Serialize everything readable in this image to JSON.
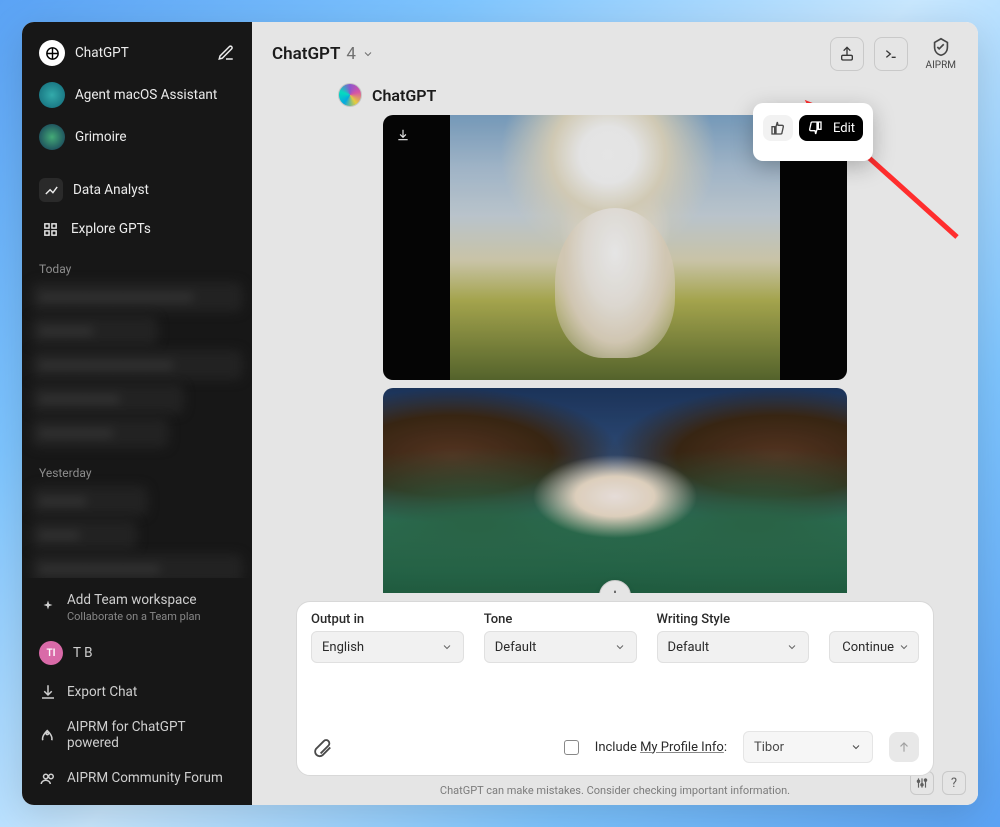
{
  "sidebar": {
    "app_name": "ChatGPT",
    "items": [
      {
        "label": "Agent macOS Assistant"
      },
      {
        "label": "Grimoire"
      },
      {
        "label": "Data Analyst"
      },
      {
        "label": "Explore GPTs"
      }
    ],
    "sections": {
      "today": "Today",
      "yesterday": "Yesterday"
    },
    "bottom": {
      "add_team": "Add Team workspace",
      "add_team_sub": "Collaborate on a Team plan",
      "user_initials": "TI",
      "user_name": "T B",
      "export_chat": "Export Chat",
      "aiprm_powered": "AIPRM for ChatGPT powered",
      "aiprm_forum": "AIPRM Community Forum"
    }
  },
  "header": {
    "model_name": "ChatGPT",
    "model_version": "4",
    "aiprm_label": "AIPRM"
  },
  "message": {
    "sender": "ChatGPT"
  },
  "popover": {
    "edit_label": "Edit"
  },
  "composer": {
    "output_in_label": "Output in",
    "output_in_value": "English",
    "tone_label": "Tone",
    "tone_value": "Default",
    "writing_label": "Writing Style",
    "writing_value": "Default",
    "continue_label": "Continue",
    "include_label_prefix": "Include ",
    "include_label_link": "My Profile Info",
    "include_label_suffix": ":",
    "profile_value": "Tibor"
  },
  "footer": {
    "disclaimer": "ChatGPT can make mistakes. Consider checking important information.",
    "help": "?"
  }
}
